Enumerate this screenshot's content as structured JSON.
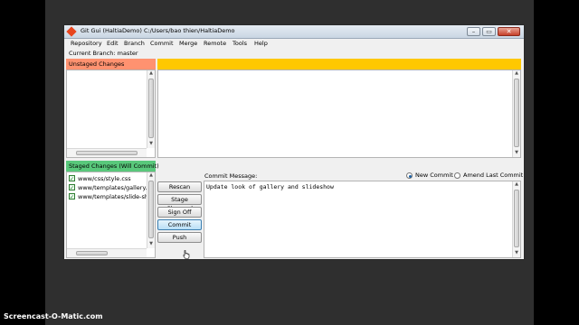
{
  "window": {
    "title": "Git Gui (HaltiaDemo) C:/Users/bao thien/HaltiaDemo",
    "controls": {
      "minimize": "–",
      "maximize": "▭",
      "close": "✕"
    }
  },
  "menubar": {
    "items": [
      "Repository",
      "Edit",
      "Branch",
      "Commit",
      "Merge",
      "Remote",
      "Tools",
      "Help"
    ]
  },
  "branch": {
    "label": "Current Branch: master"
  },
  "unstaged": {
    "header": "Unstaged Changes"
  },
  "staged": {
    "header": "Staged Changes (Will Commit)",
    "files": [
      "www/css/style.css",
      "www/templates/gallery.",
      "www/templates/slide-sh"
    ]
  },
  "actions": {
    "rescan": "Rescan",
    "stage_changed": "Stage Changed",
    "sign_off": "Sign Off",
    "commit": "Commit",
    "push": "Push"
  },
  "commit_panel": {
    "label": "Commit Message:",
    "new_commit": "New Commit",
    "amend": "Amend Last Commit",
    "selected_mode": "New Commit",
    "message": "Update look of gallery and slideshow"
  },
  "watermark": "Screencast-O-Matic.com",
  "colors": {
    "unstaged_header": "#ff9270",
    "staged_header": "#59c87b",
    "diff_header": "#ffc800"
  }
}
